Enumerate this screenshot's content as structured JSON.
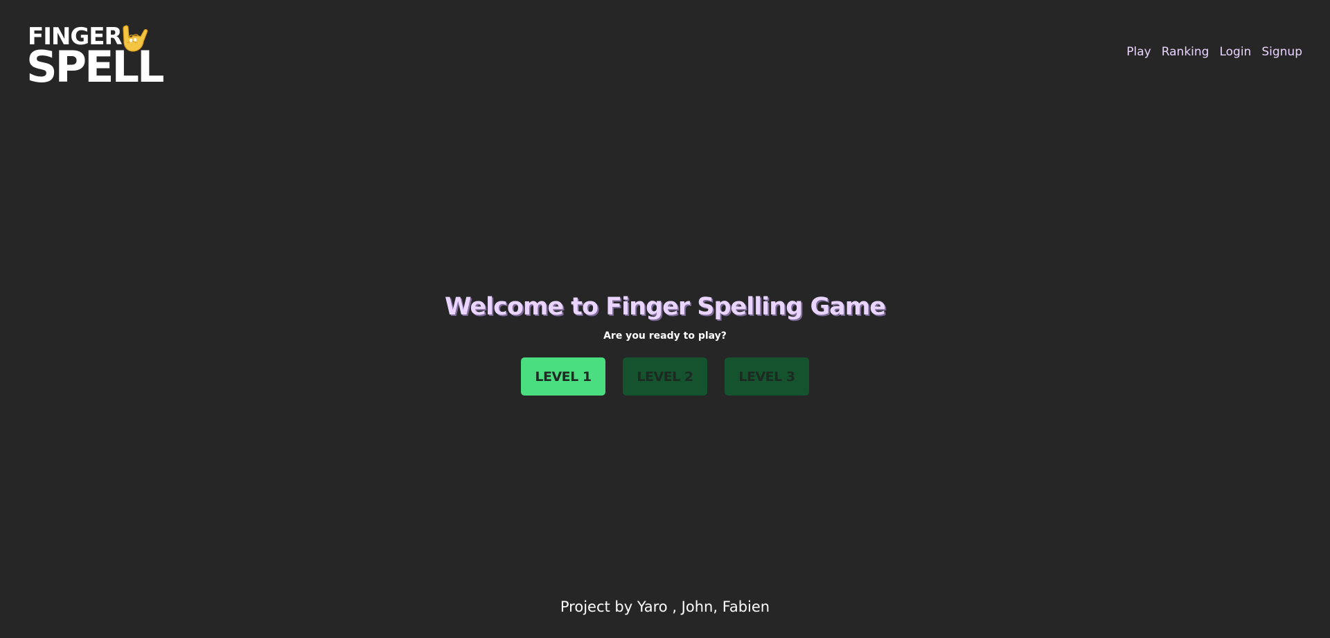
{
  "header": {
    "logo": {
      "line1": "FINGER",
      "line2": "SPELL",
      "icon": "rock-hand-icon"
    },
    "nav": [
      {
        "label": "Play"
      },
      {
        "label": "Ranking"
      },
      {
        "label": "Login"
      },
      {
        "label": "Signup"
      }
    ]
  },
  "hero": {
    "title": "Welcome to Finger Spelling Game",
    "subtitle": "Are you ready to play?",
    "levels": [
      {
        "label": "LEVEL 1",
        "state": "active"
      },
      {
        "label": "LEVEL 2",
        "state": "locked"
      },
      {
        "label": "LEVEL 3",
        "state": "locked"
      }
    ]
  },
  "footer": {
    "text": "Project by Yaro , John, Fabien"
  },
  "colors": {
    "background": "#262626",
    "nav_text": "#e9d5ff",
    "title": "#e9d5ff",
    "level_active": "#4ade80",
    "level_locked": "#14532d",
    "hand_icon": "#f4c542"
  }
}
